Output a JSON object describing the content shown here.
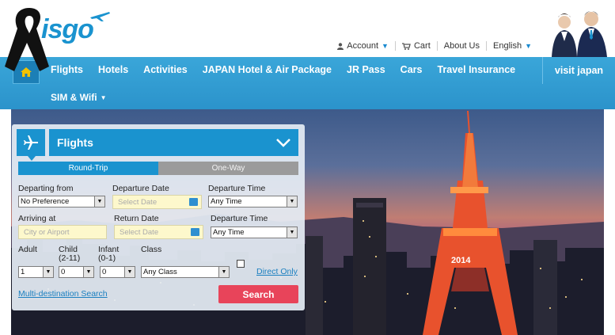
{
  "brand": {
    "logo_text": "isgo"
  },
  "top_nav": {
    "account": "Account",
    "cart": "Cart",
    "about": "About Us",
    "language": "English"
  },
  "main_nav": {
    "items": [
      "Flights",
      "Hotels",
      "Activities",
      "JAPAN Hotel & Air Package",
      "JR Pass",
      "Cars",
      "Travel Insurance"
    ],
    "visit": "visit japan",
    "sim": "SIM & Wifi"
  },
  "hero": {
    "tower_sign": "2014"
  },
  "search": {
    "title": "Flights",
    "trip_types": [
      "Round-Trip",
      "One-Way"
    ],
    "departing_label": "Departing from",
    "departing_value": "No Preference",
    "departure_date_label": "Departure Date",
    "departure_date_placeholder": "Select Date",
    "departure_time_label": "Departure Time",
    "departure_time_value": "Any Time",
    "arriving_label": "Arriving at",
    "arriving_placeholder": "City or Airport",
    "return_date_label": "Return Date",
    "return_date_placeholder": "Select Date",
    "return_time_label": "Departure Time",
    "return_time_value": "Any Time",
    "adult_label": "Adult",
    "child_label": "Child",
    "child_sub": "(2-11)",
    "infant_label": "Infant",
    "infant_sub": "(0-1)",
    "class_label": "Class",
    "adult_value": "1",
    "child_value": "0",
    "infant_value": "0",
    "class_value": "Any Class",
    "direct_only": "Direct Only",
    "multi_destination": "Multi-destination Search",
    "search_button": "Search"
  },
  "colors": {
    "accent": "#1a93cf",
    "search_button": "#e8445a",
    "nav_bg": "#2b93cb"
  }
}
